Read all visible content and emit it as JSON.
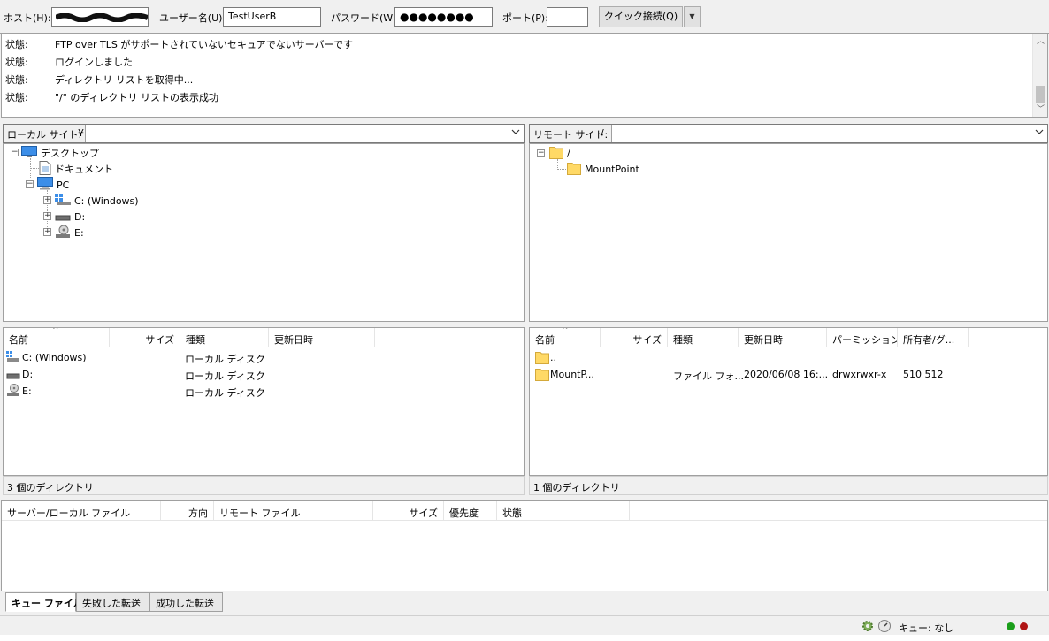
{
  "quickconnect": {
    "host_label": "ホスト(H):",
    "user_label": "ユーザー名(U):",
    "user_value": "TestUserB",
    "pass_label": "パスワード(W):",
    "pass_value": "●●●●●●●●",
    "port_label": "ポート(P):",
    "port_value": "",
    "connect_button": "クイック接続(Q)",
    "dropdown_glyph": "▼"
  },
  "log": {
    "entries": [
      {
        "status": "状態:",
        "message": "FTP over TLS がサポートされていないセキュアでないサーバーです"
      },
      {
        "status": "状態:",
        "message": "ログインしました"
      },
      {
        "status": "状態:",
        "message": "ディレクトリ リストを取得中..."
      },
      {
        "status": "状態:",
        "message": "\"/\" のディレクトリ リストの表示成功"
      }
    ],
    "scroll_up": "︿",
    "scroll_down": "﹀"
  },
  "local": {
    "site_label": "ローカル サイト:",
    "site_path": "¥",
    "tree": {
      "desktop": "デスクトップ",
      "documents": "ドキュメント",
      "pc": "PC",
      "c_drive": "C: (Windows)",
      "d_drive": "D:",
      "e_drive": "E:"
    },
    "columns": [
      "名前",
      "サイズ",
      "種類",
      "更新日時"
    ],
    "rows": [
      {
        "name": "C: (Windows)",
        "size": "",
        "type": "ローカル ディスク",
        "modified": ""
      },
      {
        "name": "D:",
        "size": "",
        "type": "ローカル ディスク",
        "modified": ""
      },
      {
        "name": "E:",
        "size": "",
        "type": "ローカル ディスク",
        "modified": ""
      }
    ],
    "status": "3 個のディレクトリ"
  },
  "remote": {
    "site_label": "リモート サイト:",
    "site_path": "/",
    "tree": {
      "root": "/",
      "mountpoint": "MountPoint"
    },
    "columns": [
      "名前",
      "サイズ",
      "種類",
      "更新日時",
      "パーミッション",
      "所有者/グ..."
    ],
    "rows": [
      {
        "name": "..",
        "size": "",
        "type": "",
        "modified": "",
        "perms": "",
        "owner": ""
      },
      {
        "name": "MountP...",
        "size": "",
        "type": "ファイル フォ...",
        "modified": "2020/06/08 16:...",
        "perms": "drwxrwxr-x",
        "owner": "510 512"
      }
    ],
    "status": "1 個のディレクトリ"
  },
  "queue": {
    "columns": [
      "サーバー/ローカル ファイル",
      "方向",
      "リモート ファイル",
      "サイズ",
      "優先度",
      "状態"
    ],
    "tabs": [
      "キュー ファイル",
      "失敗した転送",
      "成功した転送"
    ],
    "active_tab": 0
  },
  "statusbar": {
    "queue_text": "キュー: なし",
    "led_colors": [
      "#1a9e1a",
      "#b01515"
    ]
  },
  "colors": {
    "folder": "#ffd966",
    "accent_blue": "#3c8ee8"
  }
}
